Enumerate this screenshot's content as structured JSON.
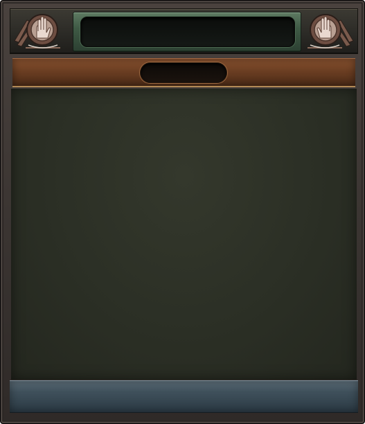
{
  "header": {
    "title": "",
    "left_emblem_icon": "raised-hand-emblem-icon",
    "right_emblem_icon": "raised-hand-emblem-icon"
  },
  "titlebar": {
    "title": ""
  },
  "footer": {
    "text": ""
  },
  "colors": {
    "frame": "#3b3532",
    "header_plate": "#3f5a45",
    "titlebar": "#6b3e22",
    "content": "#2b2f25",
    "footer": "#3f505b"
  }
}
